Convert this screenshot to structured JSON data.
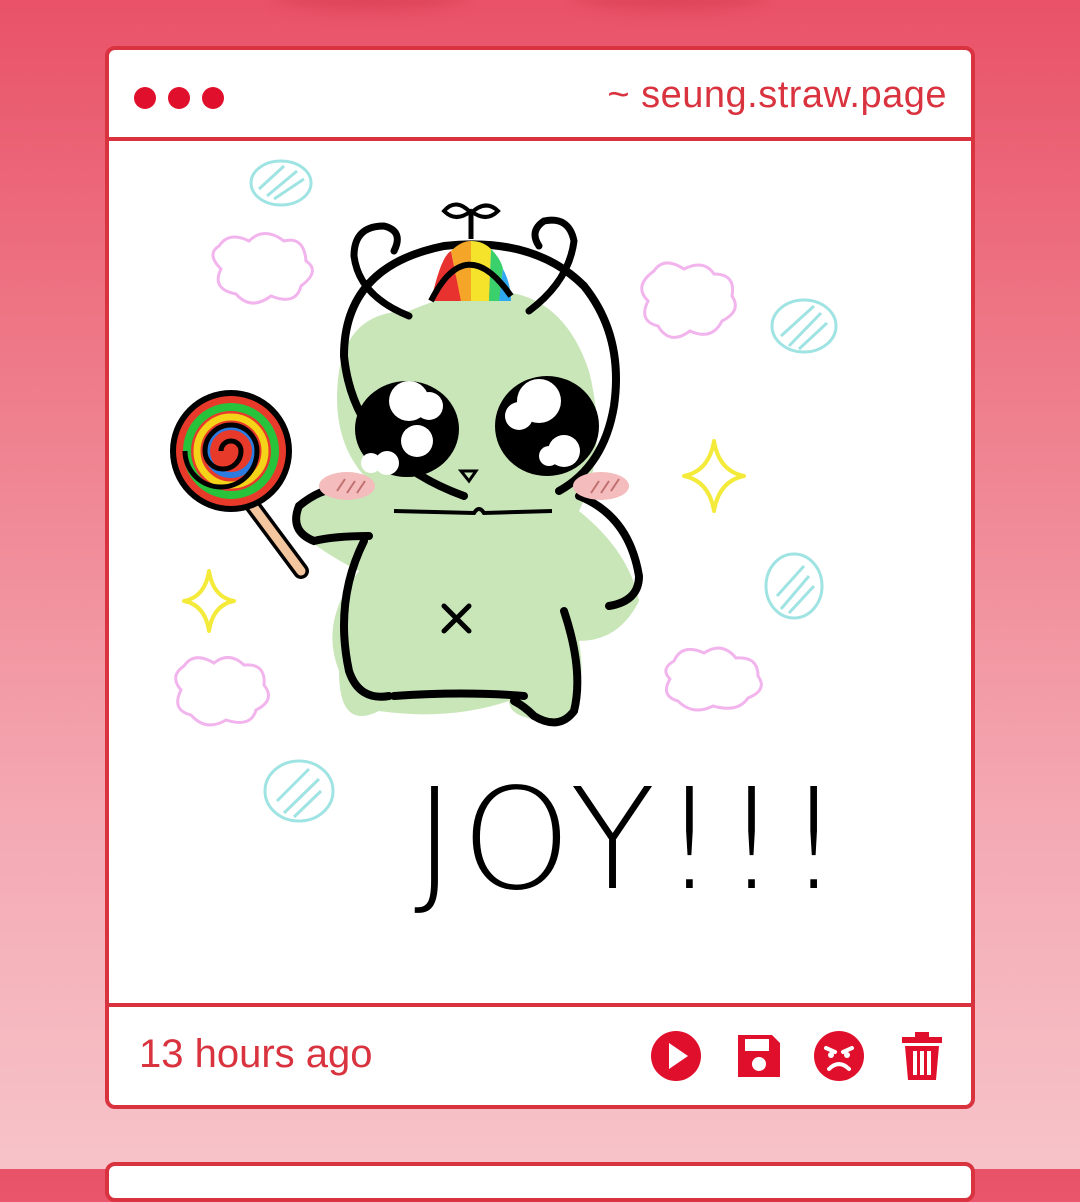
{
  "window": {
    "url": "~ seung.straw.page"
  },
  "drawing": {
    "caption": "JOY!!!"
  },
  "footer": {
    "timestamp": "13 hours ago",
    "actions": [
      {
        "icon": "play-icon"
      },
      {
        "icon": "save-icon"
      },
      {
        "icon": "angry-face-icon"
      },
      {
        "icon": "trash-icon"
      }
    ]
  },
  "colors": {
    "accent": "#d9333f",
    "dot": "#e0102c"
  }
}
